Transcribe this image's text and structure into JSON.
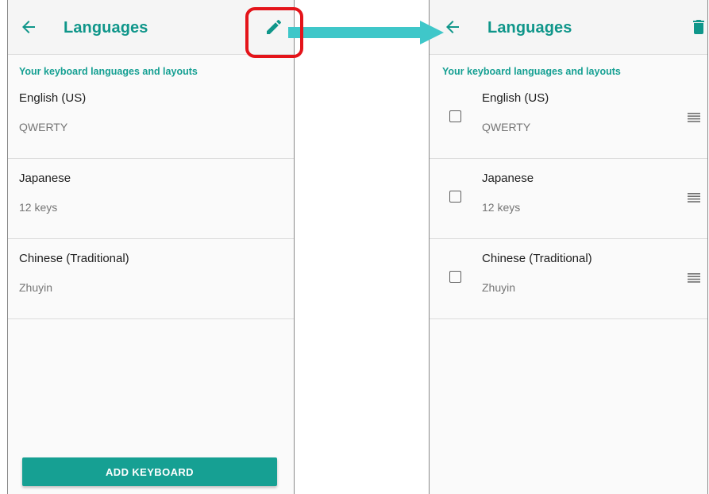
{
  "colors": {
    "accent": "#16a093",
    "title": "#0f968a",
    "highlight": "#e4141a",
    "arrow": "#3fc7c9"
  },
  "left_screen": {
    "back_icon": "arrow-back-icon",
    "title": "Languages",
    "action_icon": "pencil-edit-icon",
    "section_header": "Your keyboard languages and layouts",
    "languages": [
      {
        "name": "English (US)",
        "layout": "QWERTY"
      },
      {
        "name": "Japanese",
        "layout": "12 keys"
      },
      {
        "name": "Chinese (Traditional)",
        "layout": "Zhuyin"
      }
    ],
    "add_button_label": "ADD KEYBOARD"
  },
  "right_screen": {
    "back_icon": "arrow-back-icon",
    "title": "Languages",
    "action_icon": "trash-delete-icon",
    "section_header": "Your keyboard languages and layouts",
    "languages": [
      {
        "name": "English (US)",
        "layout": "QWERTY",
        "checked": false
      },
      {
        "name": "Japanese",
        "layout": "12 keys",
        "checked": false
      },
      {
        "name": "Chinese (Traditional)",
        "layout": "Zhuyin",
        "checked": false
      }
    ],
    "row_handle_icon": "drag-handle-icon"
  },
  "annotations": {
    "highlight": "red rounded box around edit icon",
    "arrow": "teal arrow pointing to edit-mode screen"
  }
}
